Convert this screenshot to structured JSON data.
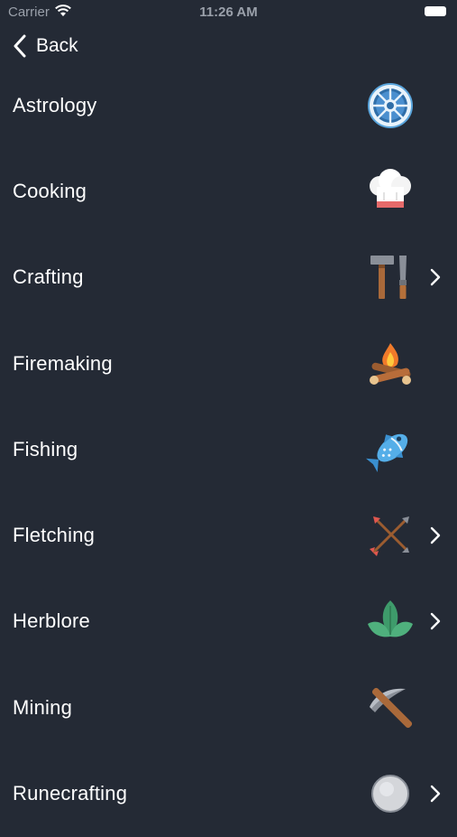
{
  "status_bar": {
    "carrier": "Carrier",
    "time": "11:26 AM"
  },
  "nav": {
    "back_label": "Back"
  },
  "skills": [
    {
      "label": "Astrology",
      "icon": "astrology-wheel-icon",
      "has_disclosure": false
    },
    {
      "label": "Cooking",
      "icon": "chef-hat-icon",
      "has_disclosure": false
    },
    {
      "label": "Crafting",
      "icon": "hammer-chisel-icon",
      "has_disclosure": true
    },
    {
      "label": "Firemaking",
      "icon": "campfire-icon",
      "has_disclosure": false
    },
    {
      "label": "Fishing",
      "icon": "fish-icon",
      "has_disclosure": false
    },
    {
      "label": "Fletching",
      "icon": "arrows-icon",
      "has_disclosure": true
    },
    {
      "label": "Herblore",
      "icon": "herb-leaves-icon",
      "has_disclosure": true
    },
    {
      "label": "Mining",
      "icon": "pickaxe-icon",
      "has_disclosure": false
    },
    {
      "label": "Runecrafting",
      "icon": "rune-stone-icon",
      "has_disclosure": true
    }
  ],
  "colors": {
    "background": "#242a35",
    "text": "#ffffff",
    "status_text": "#9aa0aa"
  }
}
